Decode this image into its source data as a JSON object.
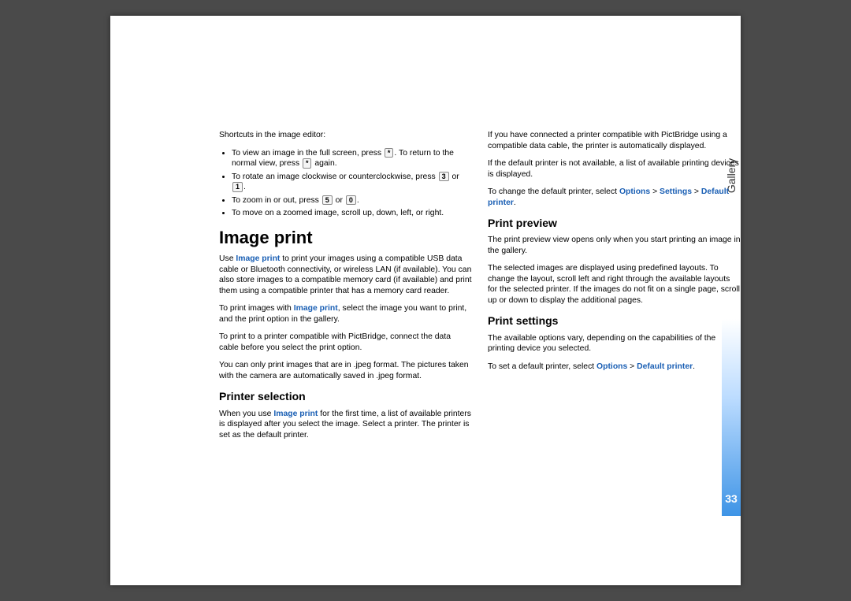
{
  "sideLabel": "Gallery",
  "pageNumber": "33",
  "shortcutsIntro": "Shortcuts in the image editor:",
  "bullets": {
    "b1a": "To view an image in the full screen, press ",
    "b1b": ". To return to the normal view, press ",
    "b1c": " again.",
    "b2a": "To rotate an image clockwise or counterclockwise, press ",
    "b2b": " or ",
    "b2c": ".",
    "b3a": "To zoom in or out, press ",
    "b3b": " or ",
    "b3c": ".",
    "b4": "To move on a zoomed image, scroll up, down, left, or right."
  },
  "keys": {
    "star": "*",
    "three": "3",
    "one": "1",
    "five": "5",
    "zero": "0"
  },
  "h1": "Image print",
  "ip": {
    "p1a": "Use ",
    "p1b": "Image print",
    "p1c": " to print your images using a compatible USB data cable or Bluetooth connectivity, or wireless LAN (if available). You can also store images to a compatible memory card (if available) and print them using a compatible printer that has a memory card reader.",
    "p2a": "To print images with ",
    "p2b": "Image print",
    "p2c": ", select the image you want to print, and the print option in the gallery.",
    "p3": "To print to a printer compatible with PictBridge, connect the data cable before you select the print option.",
    "p4": "You can only print images that are in .jpeg format. The pictures taken with the camera are automatically saved in .jpeg format."
  },
  "h2a": "Printer selection",
  "ps": {
    "p1a": "When you use ",
    "p1b": "Image print",
    "p1c": " for the first time, a list of available printers is displayed after you select the image. Select a printer. The printer is set as the default printer.",
    "p2": "If you have connected a printer compatible with PictBridge using a compatible data cable, the printer is automatically displayed.",
    "p3": "If the default printer is not available, a list of available printing devices is displayed.",
    "p4a": "To change the default printer, select ",
    "p4b": "Options",
    "p4c": " > ",
    "p4d": "Settings",
    "p4e": " > ",
    "p4f": "Default printer",
    "p4g": "."
  },
  "h2b": "Print preview",
  "pp": {
    "p1": "The print preview view opens only when you start printing an image in the gallery.",
    "p2": "The selected images are displayed using predefined layouts. To change the layout, scroll left and right through the available layouts for the selected printer. If the images do not fit on a single page, scroll up or down to display the additional pages."
  },
  "h2c": "Print settings",
  "pst": {
    "p1": "The available options vary, depending on the capabilities of the printing device you selected.",
    "p2a": "To set a default printer, select ",
    "p2b": "Options",
    "p2c": " > ",
    "p2d": "Default printer",
    "p2e": "."
  }
}
